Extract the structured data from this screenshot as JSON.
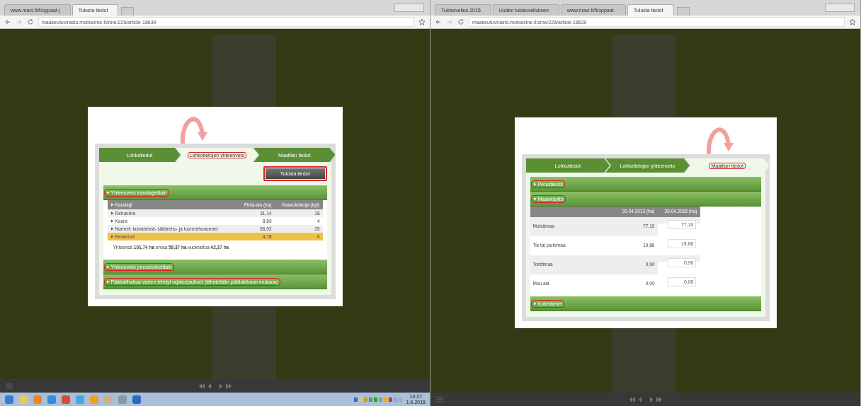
{
  "left_window": {
    "tabs": [
      {
        "title": "www.mavi.fi/fi/oppaat-j",
        "selected": false
      },
      {
        "title": "Tulosta tiedot",
        "selected": true
      }
    ],
    "url": "maaseutuvirasto.mobiezine.fi/zine/226/article-18639",
    "modal": {
      "steps": [
        {
          "label": "Lohkotiedot",
          "selected": false,
          "annotated": false
        },
        {
          "label": "Lohkotietojen yhteenveto",
          "selected": true,
          "annotated": true
        },
        {
          "label": "Maatilan tiedot",
          "selected": false,
          "annotated": false
        }
      ],
      "print_button": {
        "label": "Tulosta tiedot",
        "annotated": true
      },
      "sections": [
        {
          "title": "Yhteenveto kasvilajeittain",
          "expanded": true,
          "annotated": true,
          "table": {
            "columns": [
              "Kasvilaji",
              "Pinta-ala (ha)",
              "Kasvulohkoja (kpl)"
            ],
            "rows": [
              {
                "cells": [
                  "Rehuohra",
                  "31,14",
                  "18"
                ],
                "highlighted": false
              },
              {
                "cells": [
                  "Kaura",
                  "8,89",
                  "4"
                ],
                "highlighted": false
              },
              {
                "cells": [
                  "Nurmet: kuivaheinä- säilörehu- ja tuorerehunurmet",
                  "56,93",
                  "25"
                ],
                "highlighted": false
              },
              {
                "cells": [
                  "Kesannot",
                  "4,78",
                  "6"
                ],
                "highlighted": true
              }
            ],
            "total": "Yhteensä **101,74 ha** omaa **59,37 ha** vuokrattua **42,37 ha**"
          }
        },
        {
          "title": "Yhteenveto peruslohkoittain",
          "expanded": false,
          "annotated": true
        },
        {
          "title": "Päätukihakua varten tehdyt rajakorjaukset (lähetetään päätukihaun mukana)",
          "expanded": false,
          "annotated": true
        }
      ]
    },
    "taskbar": {
      "time": "10:27",
      "date": "1.6.2015"
    }
  },
  "right_window": {
    "tabs": [
      {
        "title": "Tukisovellus 2015",
        "selected": false
      },
      {
        "title": "Uuden tukisovelluksen",
        "selected": false
      },
      {
        "title": "www.mavi.fi/fi/oppaat-",
        "selected": false
      },
      {
        "title": "Tulosta tiedot",
        "selected": true
      }
    ],
    "url": "maaseutuvirasto.mobiezine.fi/zine/226/article-18639",
    "modal": {
      "steps": [
        {
          "label": "Lohkotiedot",
          "selected": false,
          "annotated": false
        },
        {
          "label": "Lohkotietojen yhteenveto",
          "selected": false,
          "annotated": false
        },
        {
          "label": "Maatilan tiedot",
          "selected": true,
          "annotated": true
        }
      ],
      "sections": [
        {
          "title": "Perustiedot",
          "expanded": false,
          "annotated": true
        },
        {
          "title": "Maankäyttö",
          "expanded": true,
          "annotated": true,
          "land_use": {
            "columns": [
              "30.04.2013 (ha)",
              "30.04.2015 (ha)"
            ],
            "rows": [
              {
                "name": "Metsämaa",
                "value": "77,10",
                "input": "77,10"
              },
              {
                "name": "Tie tai joutomaa",
                "value": "19,86",
                "input": "19,86"
              },
              {
                "name": "Tonttimaa",
                "value": "0,90",
                "input": "0,90"
              },
              {
                "name": "Muu ala",
                "value": "0,00",
                "input": "0,00"
              }
            ]
          }
        },
        {
          "title": "Kotieläimet",
          "expanded": false,
          "annotated": true
        }
      ]
    }
  }
}
